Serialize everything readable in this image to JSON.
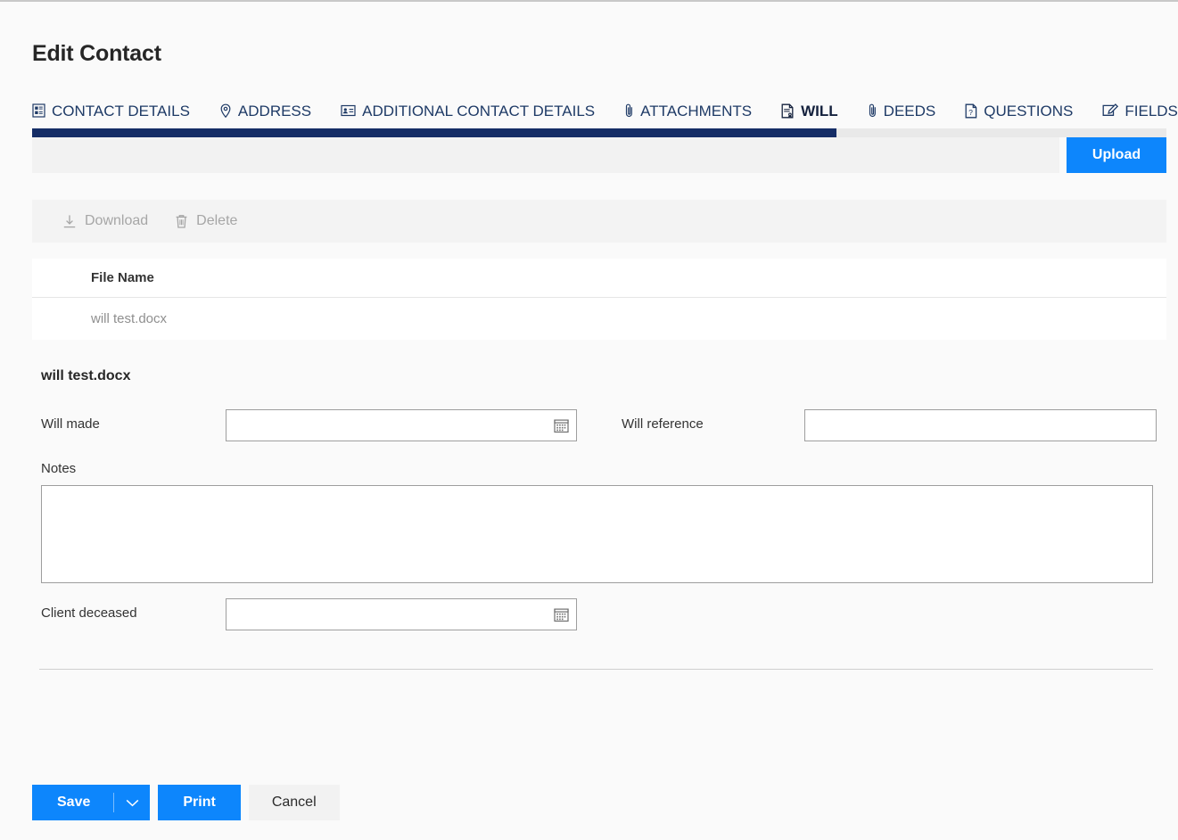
{
  "header": {
    "title": "Edit Contact"
  },
  "tabs": [
    {
      "label": "CONTACT DETAILS",
      "icon": "contact-card-icon",
      "active": false
    },
    {
      "label": "ADDRESS",
      "icon": "map-pin-icon",
      "active": false
    },
    {
      "label": "ADDITIONAL CONTACT DETAILS",
      "icon": "id-card-icon",
      "active": false
    },
    {
      "label": "ATTACHMENTS",
      "icon": "paperclip-icon",
      "active": false
    },
    {
      "label": "WILL",
      "icon": "will-document-icon",
      "active": true
    },
    {
      "label": "DEEDS",
      "icon": "paperclip-icon",
      "active": false
    },
    {
      "label": "QUESTIONS",
      "icon": "question-document-icon",
      "active": false
    },
    {
      "label": "FIELDS",
      "icon": "edit-document-icon",
      "active": false
    }
  ],
  "progress": {
    "percent": 71
  },
  "upload": {
    "label": "Upload"
  },
  "commands": [
    {
      "label": "Download",
      "icon": "download-icon",
      "disabled": true
    },
    {
      "label": "Delete",
      "icon": "trash-icon",
      "disabled": true
    }
  ],
  "file_table": {
    "columns": [
      "File Name"
    ],
    "rows": [
      {
        "file_name": "will test.docx"
      }
    ]
  },
  "detail": {
    "heading": "will test.docx",
    "will_made": {
      "label": "Will made",
      "value": "",
      "placeholder": ""
    },
    "will_reference": {
      "label": "Will reference",
      "value": "",
      "placeholder": ""
    },
    "notes": {
      "label": "Notes",
      "value": "",
      "placeholder": ""
    },
    "client_deceased": {
      "label": "Client deceased",
      "value": "",
      "placeholder": ""
    }
  },
  "footer": {
    "save_label": "Save",
    "print_label": "Print",
    "cancel_label": "Cancel"
  },
  "colors": {
    "accent_blue": "#0d86fc",
    "navy": "#152d66",
    "tab_text": "#1e3a66",
    "disabled_grey": "#a6a6a6"
  }
}
